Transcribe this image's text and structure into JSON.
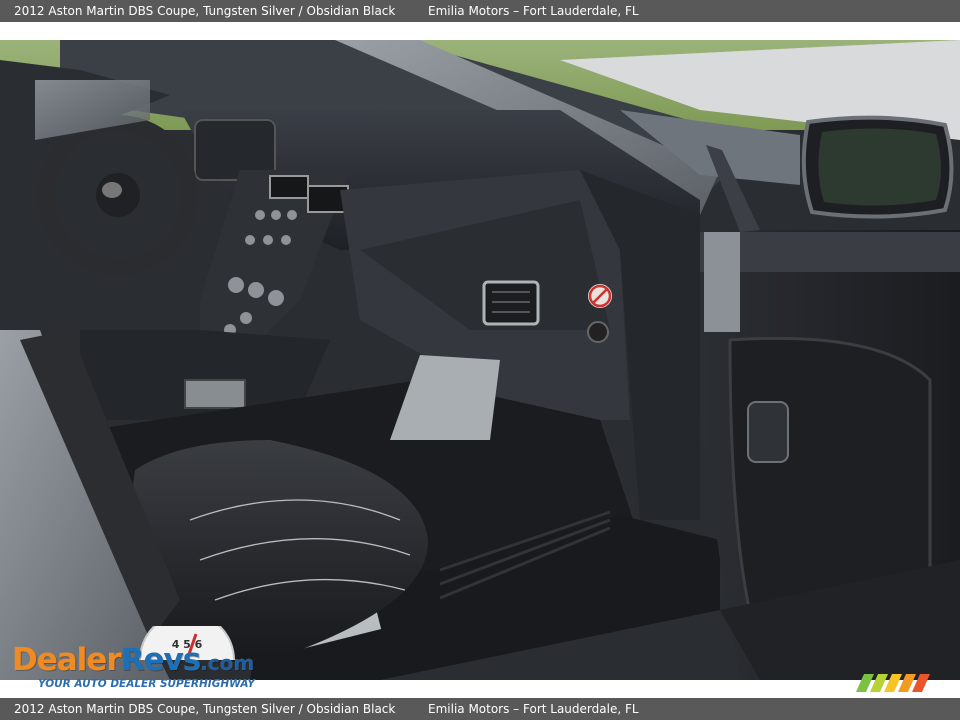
{
  "caption": {
    "title": "2012 Aston Martin DBS Coupe,  Tungsten Silver / Obsidian Black",
    "dealer": "Emilia Motors – Fort Lauderdale, FL"
  },
  "photo": {
    "subject": "car-interior-passenger-side"
  },
  "watermark": {
    "brand_dealer": "Dealer",
    "brand_revs": "Revs",
    "brand_suffix": ".com",
    "tagline": "YOUR AUTO DEALER SUPERHIGHWAY",
    "gauge_numbers": "4 5 6"
  },
  "colors": {
    "caption_bar": "#595959",
    "brand_orange": "#f08a22",
    "brand_blue": "#1d6fb8"
  }
}
